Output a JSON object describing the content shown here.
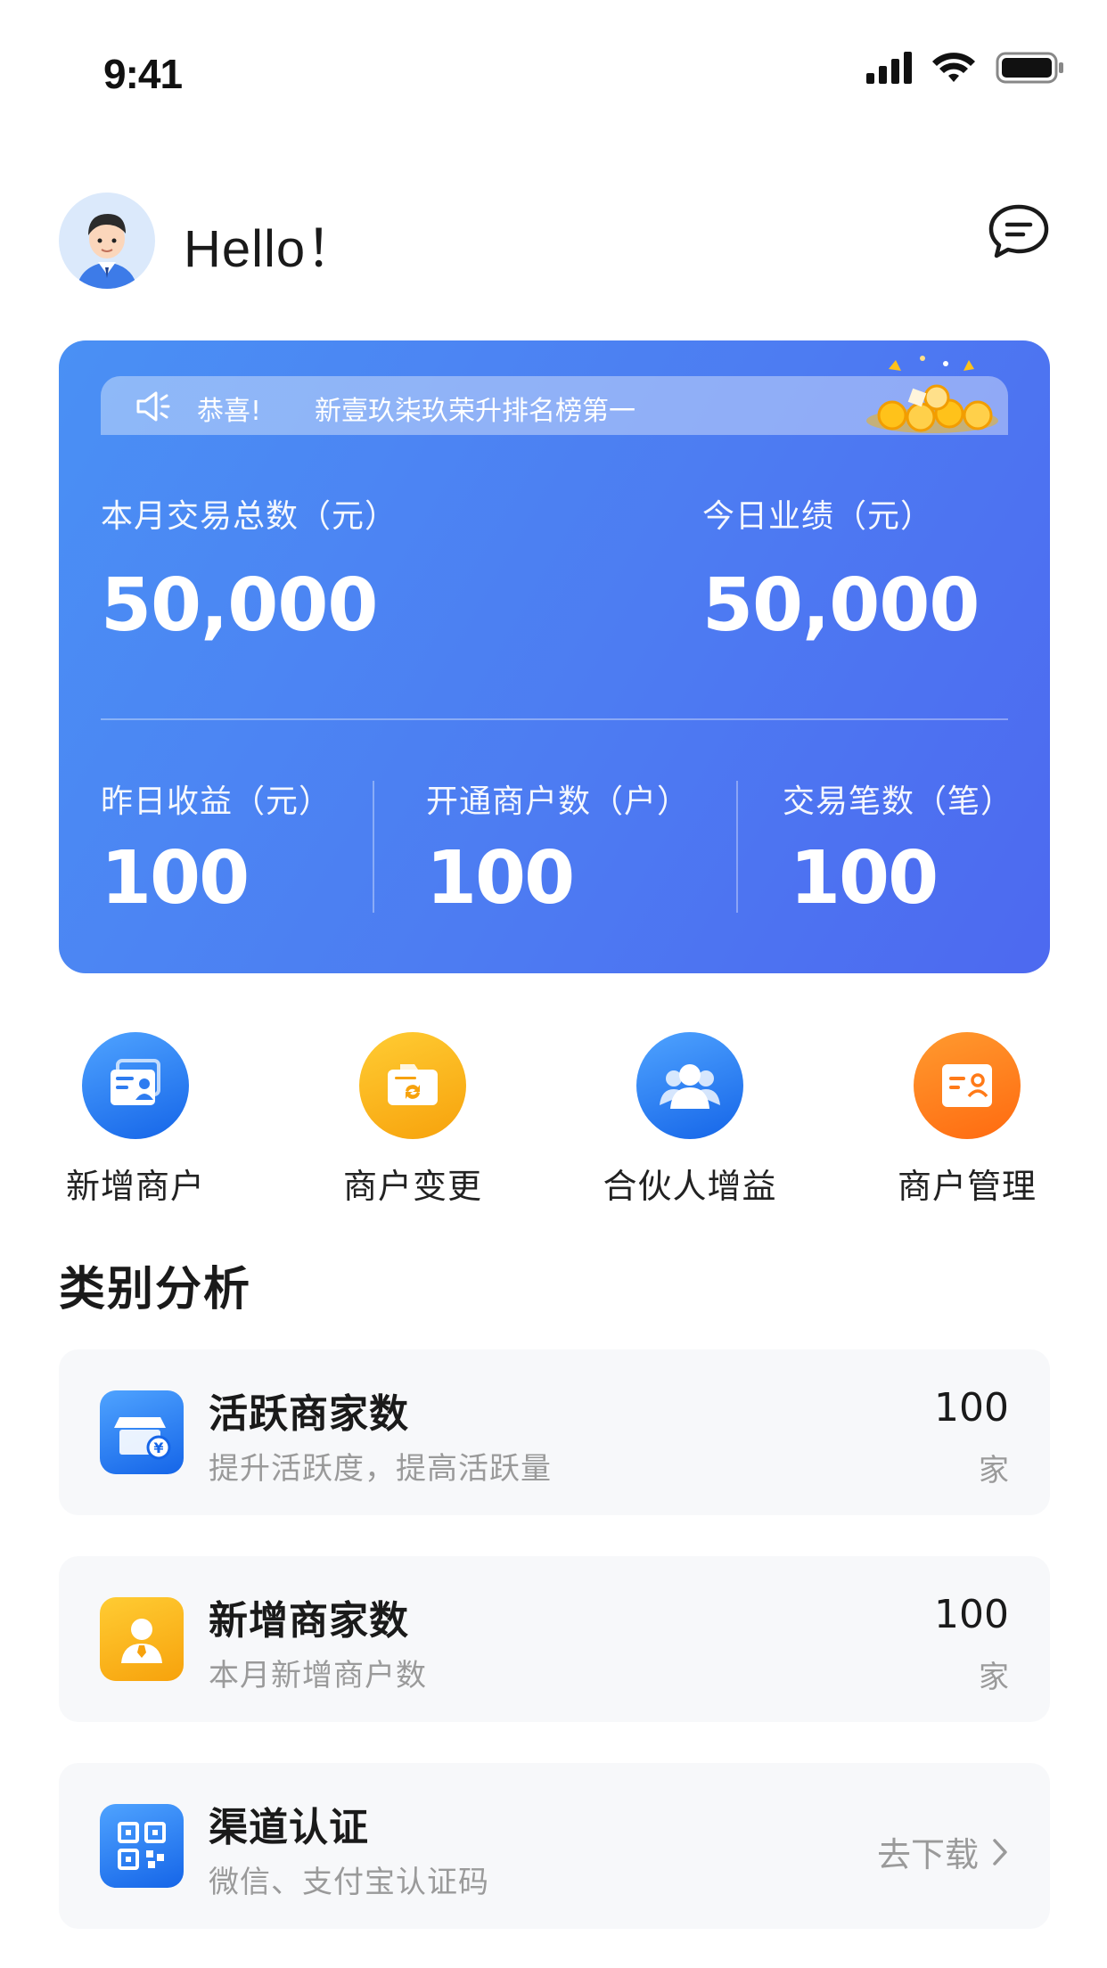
{
  "status_bar": {
    "time": "9:41"
  },
  "header": {
    "greeting": "Hello！"
  },
  "notice": {
    "congrats": "恭喜!",
    "text": "新壹玖柒玖荣升排名榜第一"
  },
  "stats": {
    "monthly_total_label": "本月交易总数（元）",
    "monthly_total_value": "50,000",
    "today_label": "今日业绩（元）",
    "today_value": "50,000",
    "yesterday_label": "昨日收益（元）",
    "yesterday_value": "100",
    "merchants_label": "开通商户数（户）",
    "merchants_value": "100",
    "transactions_label": "交易笔数（笔）",
    "transactions_value": "100"
  },
  "quick_actions": [
    {
      "label": "新增商户",
      "icon": "id-card-icon"
    },
    {
      "label": "商户变更",
      "icon": "folder-refresh-icon"
    },
    {
      "label": "合伙人增益",
      "icon": "people-icon"
    },
    {
      "label": "商户管理",
      "icon": "profile-card-icon"
    }
  ],
  "section": {
    "title": "类别分析"
  },
  "list": [
    {
      "title": "活跃商家数",
      "subtitle": "提升活跃度，提高活跃量",
      "value": "100",
      "unit": "家",
      "icon": "store-icon"
    },
    {
      "title": "新增商家数",
      "subtitle": "本月新增商户数",
      "value": "100",
      "unit": "家",
      "icon": "person-icon"
    },
    {
      "title": "渠道认证",
      "subtitle": "微信、支付宝认证码",
      "link": "去下载",
      "icon": "qr-code-icon"
    }
  ],
  "colors": {
    "card_gradient_start": "#4a90f4",
    "card_gradient_end": "#4d69f0",
    "blue_icon": "#1565e8",
    "yellow_icon": "#f7a20c",
    "orange_icon": "#ff6a10"
  }
}
